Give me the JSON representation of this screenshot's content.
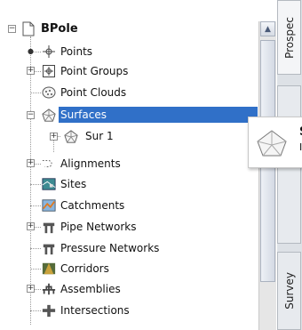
{
  "tree": {
    "root": {
      "label": "BPole",
      "expander": "−"
    },
    "items": [
      {
        "label": "Points",
        "expander": "●",
        "icon": "points-icon"
      },
      {
        "label": "Point Groups",
        "expander": "+",
        "icon": "point-groups-icon"
      },
      {
        "label": "Point Clouds",
        "expander": "",
        "icon": "point-clouds-icon"
      },
      {
        "label": "Surfaces",
        "expander": "−",
        "icon": "surfaces-icon",
        "selected": true
      },
      {
        "label": "Sur 1",
        "expander": "+",
        "icon": "surface-icon",
        "child": true
      },
      {
        "label": "Alignments",
        "expander": "+",
        "icon": "alignments-icon"
      },
      {
        "label": "Sites",
        "expander": "",
        "icon": "sites-icon"
      },
      {
        "label": "Catchments",
        "expander": "",
        "icon": "catchments-icon"
      },
      {
        "label": "Pipe Networks",
        "expander": "+",
        "icon": "pipe-networks-icon"
      },
      {
        "label": "Pressure Networks",
        "expander": "",
        "icon": "pressure-networks-icon"
      },
      {
        "label": "Corridors",
        "expander": "",
        "icon": "corridors-icon"
      },
      {
        "label": "Assemblies",
        "expander": "+",
        "icon": "assemblies-icon"
      },
      {
        "label": "Intersections",
        "expander": "",
        "icon": "intersections-icon"
      }
    ]
  },
  "tabs": [
    {
      "label": "Prospec"
    },
    {
      "label": "s"
    },
    {
      "label": "Survey"
    }
  ],
  "tooltip": {
    "line1": "S",
    "line2": "I"
  },
  "scroll_up_glyph": "▲",
  "colors": {
    "selection": "#3070c8"
  }
}
